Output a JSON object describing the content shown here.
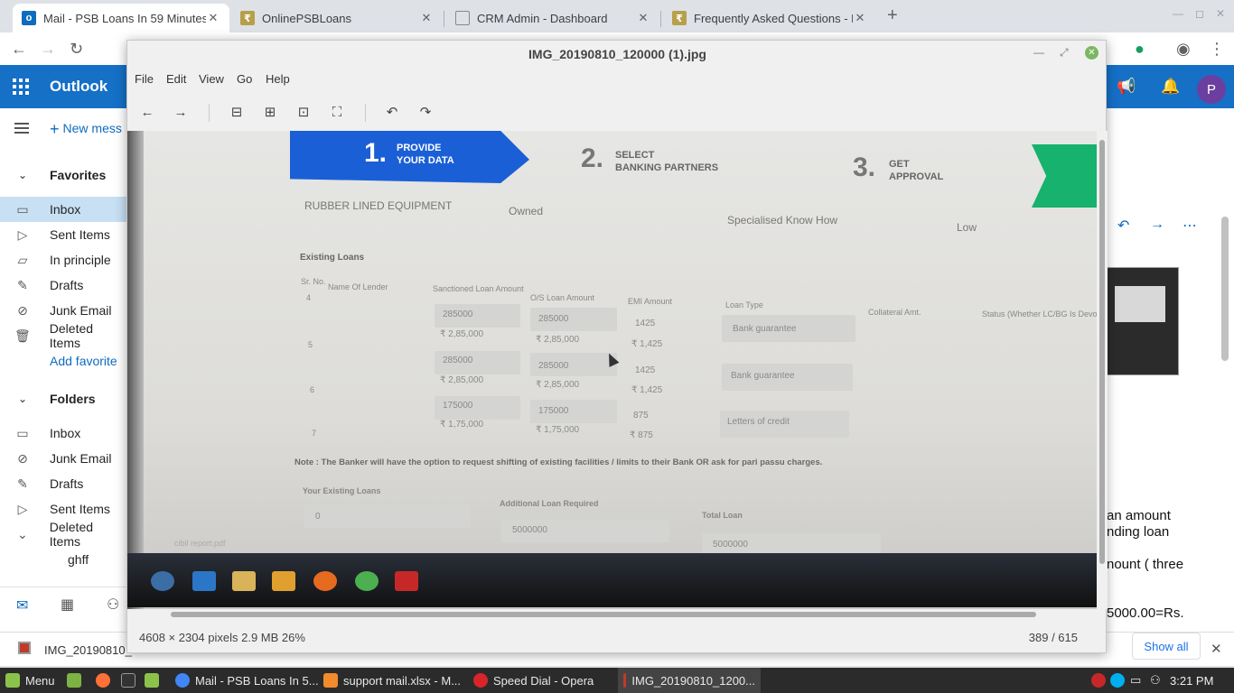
{
  "browser": {
    "tabs": [
      {
        "title": "Mail - PSB Loans In 59 Minutes",
        "fav_color": "#0f6cbd",
        "icon": "outlook-icon"
      },
      {
        "title": "OnlinePSBLoans",
        "fav_color": "#b7a04a",
        "icon": "psb-icon"
      },
      {
        "title": "CRM Admin - Dashboard",
        "fav_color": "#888888",
        "icon": "page-icon"
      },
      {
        "title": "Frequently Asked Questions - P",
        "fav_color": "#b7a04a",
        "icon": "psb-icon"
      }
    ]
  },
  "outlook": {
    "brand": "Outlook",
    "new_message": "New mess",
    "favorites_label": "Favorites",
    "favorites": [
      {
        "label": "Inbox",
        "icon": "inbox-icon"
      },
      {
        "label": "Sent Items",
        "icon": "send-icon"
      },
      {
        "label": "In principle",
        "icon": "folder-icon"
      },
      {
        "label": "Drafts",
        "icon": "pencil-icon"
      },
      {
        "label": "Junk Email",
        "icon": "block-icon"
      },
      {
        "label": "Deleted Items",
        "icon": "trash-icon"
      }
    ],
    "add_favorite": "Add favorite",
    "folders_label": "Folders",
    "folders": [
      {
        "label": "Inbox",
        "icon": "inbox-icon"
      },
      {
        "label": "Junk Email",
        "icon": "block-icon"
      },
      {
        "label": "Drafts",
        "icon": "pencil-icon"
      },
      {
        "label": "Sent Items",
        "icon": "send-icon"
      },
      {
        "label": "Deleted Items",
        "icon": "chevron-down-icon"
      }
    ],
    "subfolder": "ghff",
    "avatar_letter": "P",
    "reading_lines": [
      "an amount",
      "nding loan",
      "nount ( three",
      "5000.00=Rs."
    ]
  },
  "viewer": {
    "title": "IMG_20190810_120000 (1).jpg",
    "menu": [
      "File",
      "Edit",
      "View",
      "Go",
      "Help"
    ],
    "status_left": "4608 × 2304 pixels  2.9 MB   26%",
    "status_right": "389 / 615"
  },
  "photo": {
    "step1_num": "1.",
    "step1_lbl": "PROVIDE\nYOUR DATA",
    "step2_num": "2.",
    "step2_lbl": "SELECT\nBANKING PARTNERS",
    "step3_num": "3.",
    "step3_lbl": "GET\nAPPROVAL",
    "row_top": [
      "RUBBER LINED EQUIPMENT",
      "Owned",
      "Specialised Know How",
      "Low"
    ],
    "existing_loans": "Existing Loans",
    "headers": [
      "Sr. No.",
      "Name Of Lender",
      "Sanctioned Loan Amount",
      "O/S Loan Amount",
      "EMI Amount",
      "Loan Type",
      "Collateral Amt.",
      "Status (Whether LC/BG Is Devolved/Invoked)"
    ],
    "rows": [
      {
        "no": "4",
        "sanc": "285000",
        "sanc_fmt": "₹ 2,85,000",
        "os": "285000",
        "os_fmt": "₹ 2,85,000",
        "emi": "1425",
        "emi_fmt": "₹ 1,425",
        "type": "Bank guarantee"
      },
      {
        "no": "5",
        "sanc": "285000",
        "sanc_fmt": "₹ 2,85,000",
        "os": "285000",
        "os_fmt": "₹ 2,85,000",
        "emi": "1425",
        "emi_fmt": "₹ 1,425",
        "type": "Bank guarantee"
      },
      {
        "no": "6",
        "sanc": "175000",
        "sanc_fmt": "₹ 1,75,000",
        "os": "175000",
        "os_fmt": "₹ 1,75,000",
        "emi": "875",
        "emi_fmt": "₹ 875",
        "type": "Letters of credit"
      }
    ],
    "row7": "7",
    "note": "Note : The Banker will have the option to request shifting of existing facilities / limits to their Bank OR ask for pari passu charges.",
    "your_existing": "Your Existing Loans",
    "your_existing_val": "0",
    "additional": "Additional Loan Required",
    "additional_val": "5000000",
    "total": "Total Loan",
    "total_val": "5000000",
    "pdf_name": "cibil report.pdf"
  },
  "downloads": {
    "file": "IMG_20190810_",
    "show_all": "Show all"
  },
  "taskbar": {
    "menu": "Menu",
    "items": [
      {
        "label": "Mail - PSB Loans In 5...",
        "color": "#4285f4"
      },
      {
        "label": "support mail.xlsx - M...",
        "color": "#f28b2c"
      },
      {
        "label": "Speed Dial - Opera",
        "color": "#d9252a"
      },
      {
        "label": "IMG_20190810_1200...",
        "color": "#c0392b"
      }
    ],
    "clock": "3:21 PM"
  }
}
